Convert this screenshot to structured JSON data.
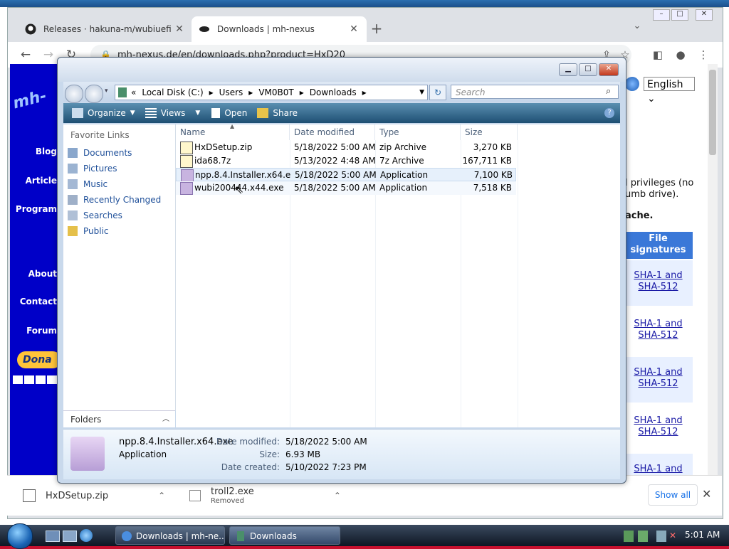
{
  "browser": {
    "tabs": [
      {
        "title": "Releases · hakuna-m/wubiuefi · C",
        "active": false
      },
      {
        "title": "Downloads | mh-nexus",
        "active": true
      }
    ],
    "url": "mh-nexus.de/en/downloads.php?product=HxD20",
    "window_controls": [
      "–",
      "□",
      "✕"
    ]
  },
  "webpage": {
    "nav_items": [
      "Blog",
      "Article",
      "Program",
      "About",
      "Contact",
      "Forum"
    ],
    "logo_text": "mh-",
    "language": "English",
    "text_fragments": [
      "l privileges (no",
      "umb drive).",
      "ache."
    ],
    "file_signatures_header": "File signatures",
    "sig_link": "SHA-1 and SHA-512",
    "donate_label": "Dona"
  },
  "downloads_bar": {
    "items": [
      {
        "name": "HxDSetup.zip",
        "status": ""
      },
      {
        "name": "troll2.exe",
        "status": "Removed"
      }
    ],
    "show_all": "Show all"
  },
  "explorer": {
    "breadcrumb": [
      "«",
      "Local Disk (C:)",
      "Users",
      "VM0B0T",
      "Downloads"
    ],
    "search_placeholder": "Search",
    "commands": [
      "Organize",
      "Views",
      "Open",
      "Share"
    ],
    "favorite_links_title": "Favorite Links",
    "favorite_links": [
      "Documents",
      "Pictures",
      "Music",
      "Recently Changed",
      "Searches",
      "Public"
    ],
    "folders_label": "Folders",
    "columns": [
      "Name",
      "Date modified",
      "Type",
      "Size"
    ],
    "files": [
      {
        "name": "HxDSetup.zip",
        "date": "5/18/2022 5:00 AM",
        "type": "zip Archive",
        "size": "3,270 KB",
        "icon": "zip-icon"
      },
      {
        "name": "ida68.7z",
        "date": "5/13/2022 4:48 AM",
        "type": "7z Archive",
        "size": "167,711 KB",
        "icon": "archive-icon"
      },
      {
        "name": "npp.8.4.Installer.x64.exe",
        "date": "5/18/2022 5:00 AM",
        "type": "Application",
        "size": "7,100 KB",
        "icon": "app-icon"
      },
      {
        "name": "wubi200444.x44.exe",
        "date": "5/18/2022 5:00 AM",
        "type": "Application",
        "size": "7,518 KB",
        "icon": "app-icon"
      }
    ],
    "details": {
      "name": "npp.8.4.Installer.x64.exe",
      "type": "Application",
      "date_modified_label": "Date modified:",
      "date_modified": "5/18/2022 5:00 AM",
      "size_label": "Size:",
      "size": "6.93 MB",
      "date_created_label": "Date created:",
      "date_created": "5/10/2022 7:23 PM"
    }
  },
  "taskbar": {
    "buttons": [
      "Downloads | mh-ne...",
      "Downloads"
    ],
    "clock": "5:01 AM"
  },
  "colors": {
    "site_nav": "#0000c8",
    "explorer_cmdbar": "#1e4f73",
    "link": "#1a1aa6"
  }
}
